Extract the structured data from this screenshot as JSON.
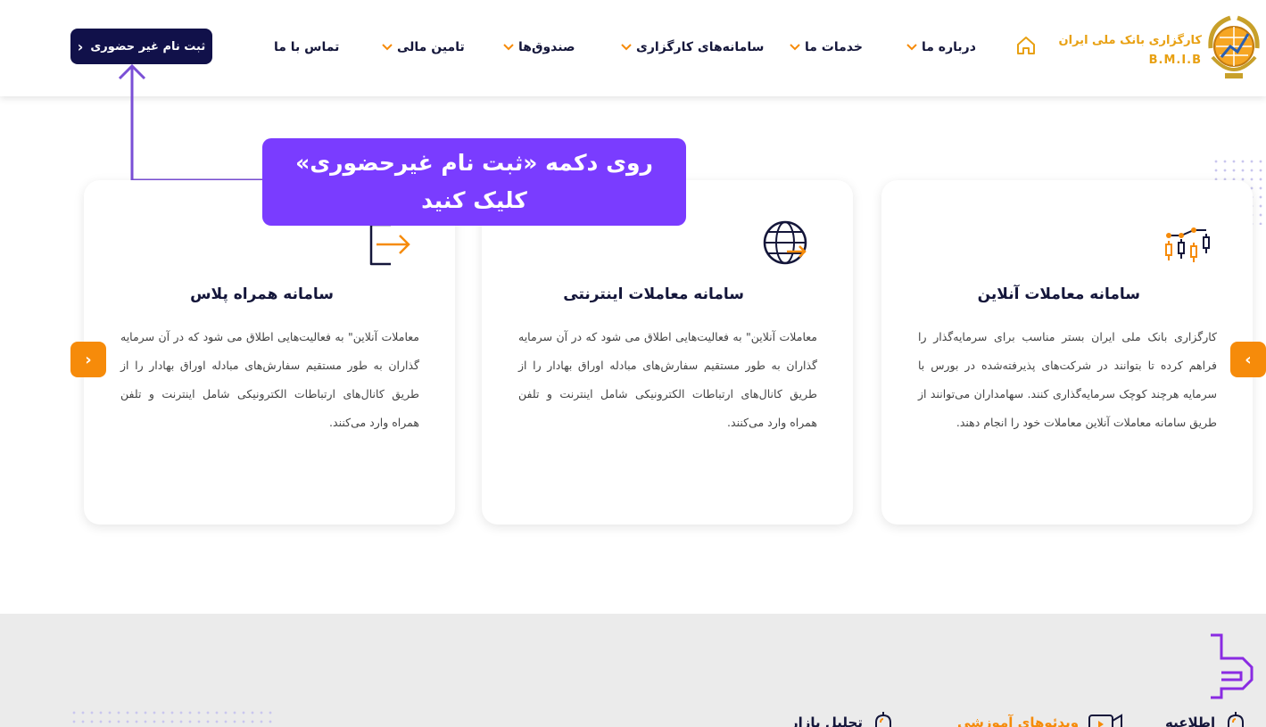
{
  "header": {
    "logo": {
      "title": "کارگزاری بانک ملی ایران",
      "subtitle": "B.M.I.B",
      "emblem_icon": "bmib-emblem-icon"
    },
    "home_icon": "home-icon",
    "nav": [
      {
        "label": "درباره ما",
        "has_dropdown": true
      },
      {
        "label": "خدمات ما",
        "has_dropdown": true
      },
      {
        "label": "سامانه‌های کارگزاری",
        "has_dropdown": true
      },
      {
        "label": "صندوق‌ها",
        "has_dropdown": true
      },
      {
        "label": "تامین مالی",
        "has_dropdown": true
      },
      {
        "label": "تماس با ما",
        "has_dropdown": false
      }
    ],
    "register_button": "ثبت نام غیر حضوری",
    "accent_color": "#f68b0a",
    "brand_color": "#11114a"
  },
  "callout": {
    "line1": "روی دکمه «ثبت نام غیرحضوری»",
    "line2": "کلیک کنید",
    "color": "#7a3cff"
  },
  "cards": [
    {
      "title": "سامانه معاملات آنلاین",
      "icon": "candlestick-chart-icon",
      "text": "کارگزاری بانک ملی ایران بستر مناسب برای سرمایه‌گذار را فراهم کرده تا بتوانند در شرکت‌های پذیرفته‌شده در بورس با سرمایه هرچند کوچک سرمایه‌گذاری کنند. سهامداران می‌توانند از طریق سامانه معاملات آنلاین معاملات خود را انجام دهند."
    },
    {
      "title": "سامانه معاملات اینترنتی",
      "icon": "globe-arrow-icon",
      "text": "معاملات آنلاین\" به فعالیت‌هایی اطلاق می شود که در آن سرمایه گذاران به طور مستقیم سفارش‌های مبادله اوراق بهادار را از طریق کانال‌های ارتباطات الکترونیکی شامل اینترنت و تلفن همراه وارد می‌کنند."
    },
    {
      "title": "سامانه همراه پلاس",
      "icon": "mobile-login-icon",
      "text": "معاملات آنلاین\" به فعالیت‌هایی اطلاق می شود که در آن سرمایه گذاران به طور مستقیم سفارش‌های مبادله اوراق بهادار را از طریق کانال‌های ارتباطات الکترونیکی شامل اینترنت و تلفن همراه وارد می‌کنند."
    }
  ],
  "carousel": {
    "prev_icon": "chevron-left-icon",
    "next_icon": "chevron-right-icon"
  },
  "footer": {
    "items": [
      {
        "label": "اطلاعیه",
        "icon": "bell-icon",
        "color": "#14163a"
      },
      {
        "label": "ویدئوهای آموزشی",
        "icon": "video-icon",
        "color": "#f68b0a"
      },
      {
        "label": "تحلیل بازار",
        "icon": "bell-icon",
        "color": "#14163a"
      }
    ],
    "logo_icon": "site-watermark-logo-icon"
  }
}
